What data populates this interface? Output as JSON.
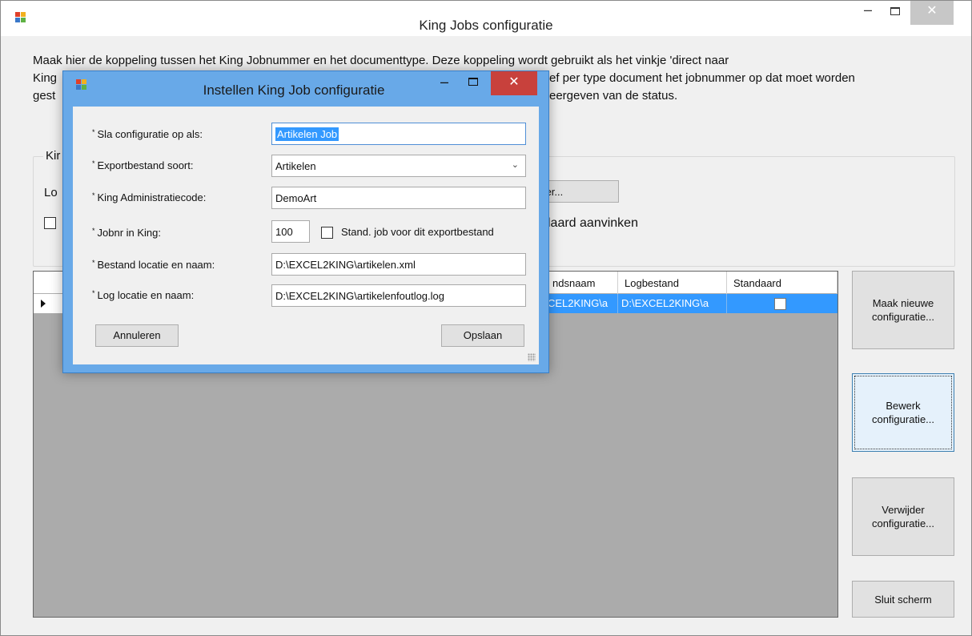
{
  "main_window": {
    "title": "King Jobs configuratie",
    "controls": {
      "minimize": "–",
      "close": "✕"
    },
    "intro_text": "Maak hier de koppeling tussen het King Jobnummer en het documenttype. Deze koppeling wordt gebruikt als het vinkje 'direct naar King' ... ef per type document het jobnummer op dat moet worden gest... eergeven van de status.",
    "intro_lines": [
      "Maak hier de koppeling tussen het King Jobnummer en het documenttype. Deze koppeling wordt gebruikt als het vinkje 'direct naar",
      "King",
      "ef per type document het jobnummer op dat moet worden",
      "gest",
      "eergeven van de status."
    ],
    "group": {
      "legend": "Kir",
      "label": "Lo",
      "checkbox_label": "laard aanvinken",
      "select_button": "ielecteer..."
    },
    "grid": {
      "columns": [
        "",
        "",
        "ndsnaam",
        "Logbestand",
        "Standaard"
      ],
      "row": {
        "bestandsnaam": "CEL2KING\\a",
        "logbestand": "D:\\EXCEL2KING\\a",
        "standaard": false
      }
    },
    "buttons": {
      "new": [
        "Maak nieuwe",
        "configuratie..."
      ],
      "edit": [
        "Bewerk",
        "configuratie..."
      ],
      "delete": [
        "Verwijder",
        "configuratie..."
      ],
      "close": "Sluit scherm"
    }
  },
  "dialog": {
    "title": "Instellen King Job configuratie",
    "controls": {
      "minimize": "–",
      "close": "✕"
    },
    "required_marker": "*",
    "fields": {
      "save_as": {
        "label": "Sla configuratie op als:",
        "value": "Artikelen Job"
      },
      "export_type": {
        "label": "Exportbestand soort:",
        "value": "Artikelen"
      },
      "admin_code": {
        "label": "King Administratiecode:",
        "value": "DemoArt"
      },
      "jobnr": {
        "label": "Jobnr in King:",
        "value": "100",
        "checkbox_label": "Stand. job voor dit exportbestand",
        "checked": false
      },
      "file_path": {
        "label": "Bestand locatie en naam:",
        "value": "D:\\EXCEL2KING\\artikelen.xml"
      },
      "log_path": {
        "label": "Log locatie en naam:",
        "value": "D:\\EXCEL2KING\\artikelenfoutlog.log"
      }
    },
    "buttons": {
      "cancel": "Annuleren",
      "save": "Opslaan"
    }
  },
  "colors": {
    "dialog_frame": "#68a9e8",
    "close_button": "#c8413c",
    "selection": "#3399ff",
    "grid_background": "#ababab"
  }
}
